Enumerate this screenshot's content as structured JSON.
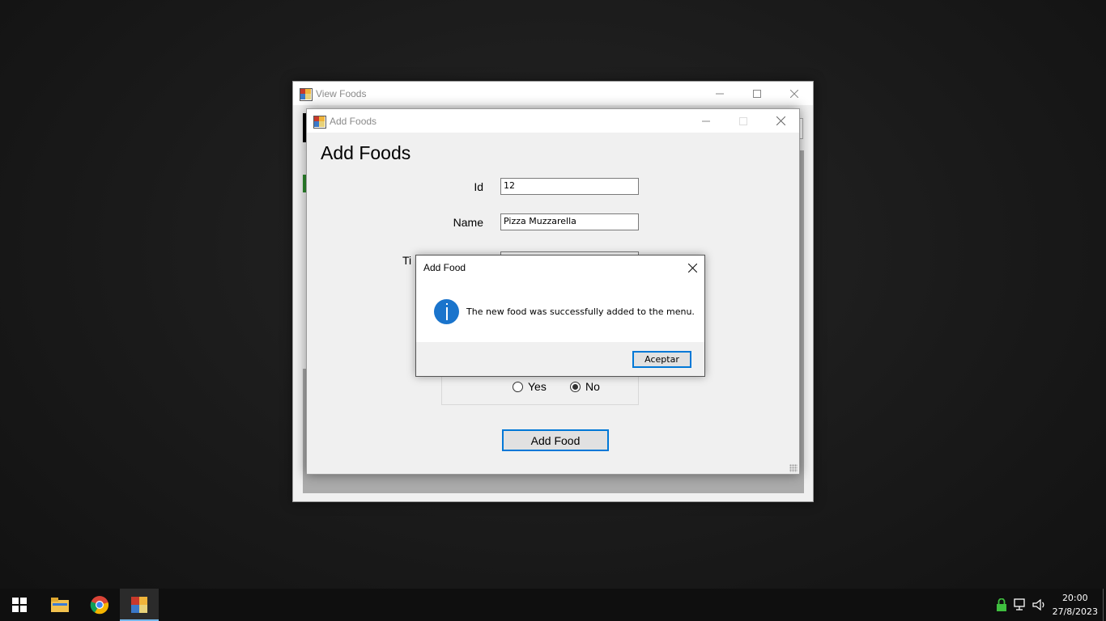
{
  "view_foods": {
    "title": "View Foods"
  },
  "add_foods": {
    "title": "Add Foods",
    "heading": "Add Foods",
    "id_label": "Id",
    "id_value": "12",
    "name_label": "Name",
    "name_value": "Pizza Muzzarella",
    "partial_label": "Ti",
    "radio_yes": "Yes",
    "radio_no": "No",
    "selected_radio": "No",
    "add_button": "Add Food"
  },
  "message_box": {
    "title": "Add Food",
    "message": "The new food was successfully added to the menu.",
    "ok_button": "Aceptar",
    "icon": "info-icon"
  },
  "taskbar": {
    "pinned": [
      "windows-start-icon",
      "file-explorer-icon",
      "chrome-icon",
      "app-icon"
    ],
    "time": "20:00",
    "date": "27/8/2023"
  },
  "colors": {
    "accent": "#0078d7",
    "info_icon": "#1a74cc"
  }
}
